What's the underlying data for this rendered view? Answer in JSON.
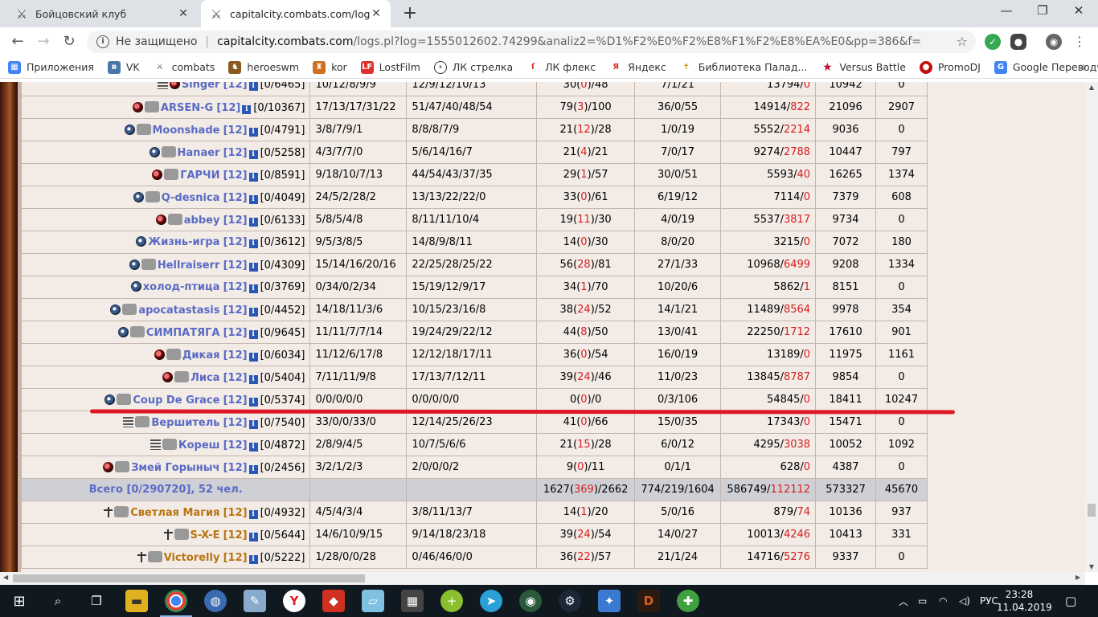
{
  "browser": {
    "tabs": [
      {
        "title": "Бойцовский клуб",
        "close": "✕"
      },
      {
        "title": "capitalcity.combats.com/logs.pl?l",
        "close": "✕"
      }
    ],
    "new_tab": "+",
    "window_controls": {
      "minimize": "—",
      "maximize": "❐",
      "close": "✕"
    },
    "address": {
      "security": "Не защищено",
      "separator": "|",
      "host": "capitalcity.combats.com",
      "path": "/logs.pl?log=1555012602.74299&analiz2=%D1%F2%E0%F2%E8%F1%F2%E8%EA%E0&pp=386&f="
    },
    "bookmarks": [
      {
        "label": "Приложения",
        "icon": "apps-grid-icon",
        "color": "#4285f4"
      },
      {
        "label": "VK",
        "icon": "vk-icon",
        "color": "#4a76a8"
      },
      {
        "label": "combats",
        "icon": "swords-icon",
        "color": "#555555"
      },
      {
        "label": "heroeswm",
        "icon": "heroes-icon",
        "color": "#8a5a20"
      },
      {
        "label": "kor",
        "icon": "kor-icon",
        "color": "#d07020"
      },
      {
        "label": "LostFilm",
        "icon": "lostfilm-icon",
        "color": "#e03030"
      },
      {
        "label": "ЛК стрелка",
        "icon": "strelka-icon",
        "color": "#333333"
      },
      {
        "label": "ЛК флекс",
        "icon": "flex-icon",
        "color": "#e03030"
      },
      {
        "label": "Яндекс",
        "icon": "yandex-icon",
        "color": "#e03030"
      },
      {
        "label": "Библиотека Палад...",
        "icon": "cross-icon",
        "color": "#c89a20"
      },
      {
        "label": "Versus Battle",
        "icon": "star-icon",
        "color": "#c01030"
      },
      {
        "label": "PromoDJ",
        "icon": "promodj-icon",
        "color": "#c01010"
      },
      {
        "label": "Google Переводчик",
        "icon": "translate-icon",
        "color": "#4285f4"
      }
    ],
    "bookmarks_more": "»"
  },
  "log_table": {
    "rows": [
      {
        "icons": [
          "grey",
          "dark"
        ],
        "name": "Singer",
        "level": "[12]",
        "hp": "[0/6465]",
        "c2": "10/12/8/9/9",
        "c3": "12/9/12/10/13",
        "c4a": "30(",
        "c4r": "0",
        "c4b": ")/48",
        "c5": "7/1/21",
        "c6a": "13794/",
        "c6r": "0",
        "c7": "10942",
        "c8": "0",
        "light": false
      },
      {
        "icons": [
          "dark",
          "clan"
        ],
        "name": "ARSEN-G",
        "level": "[12]",
        "hp": "[0/10367]",
        "c2": "17/13/17/31/22",
        "c3": "51/47/40/48/54",
        "c4a": "79(",
        "c4r": "3",
        "c4b": ")/100",
        "c5": "36/0/55",
        "c6a": "14914/",
        "c6r": "822",
        "c7": "21096",
        "c8": "2907",
        "light": false
      },
      {
        "icons": [
          "align",
          "clan"
        ],
        "name": "Moonshade",
        "level": "[12]",
        "hp": "[0/4791]",
        "c2": "3/8/7/9/1",
        "c3": "8/8/8/7/9",
        "c4a": "21(",
        "c4r": "12",
        "c4b": ")/28",
        "c5": "1/0/19",
        "c6a": "5552/",
        "c6r": "2214",
        "c7": "9036",
        "c8": "0",
        "light": false
      },
      {
        "icons": [
          "align",
          "clan"
        ],
        "name": "Hanaer",
        "level": "[12]",
        "hp": "[0/5258]",
        "c2": "4/3/7/7/0",
        "c3": "5/6/14/16/7",
        "c4a": "21(",
        "c4r": "4",
        "c4b": ")/21",
        "c5": "7/0/17",
        "c6a": "9274/",
        "c6r": "2788",
        "c7": "10447",
        "c8": "797",
        "light": false
      },
      {
        "icons": [
          "dark",
          "clan"
        ],
        "name": "ГАРЧИ",
        "level": "[12]",
        "hp": "[0/8591]",
        "c2": "9/18/10/7/13",
        "c3": "44/54/43/37/35",
        "c4a": "29(",
        "c4r": "1",
        "c4b": ")/57",
        "c5": "30/0/51",
        "c6a": "5593/",
        "c6r": "40",
        "c7": "16265",
        "c8": "1374",
        "light": false
      },
      {
        "icons": [
          "align",
          "clan"
        ],
        "name": "Q-desnica",
        "level": "[12]",
        "hp": "[0/4049]",
        "c2": "24/5/2/28/2",
        "c3": "13/13/22/22/0",
        "c4a": "33(",
        "c4r": "0",
        "c4b": ")/61",
        "c5": "6/19/12",
        "c6a": "7114/",
        "c6r": "0",
        "c7": "7379",
        "c8": "608",
        "light": false
      },
      {
        "icons": [
          "dark",
          "clan"
        ],
        "name": "abbey",
        "level": "[12]",
        "hp": "[0/6133]",
        "c2": "5/8/5/4/8",
        "c3": "8/11/11/10/4",
        "c4a": "19(",
        "c4r": "11",
        "c4b": ")/30",
        "c5": "4/0/19",
        "c6a": "5537/",
        "c6r": "3817",
        "c7": "9734",
        "c8": "0",
        "light": false
      },
      {
        "icons": [
          "align"
        ],
        "name": "Жизнь-игра",
        "level": "[12]",
        "hp": "[0/3612]",
        "c2": "9/5/3/8/5",
        "c3": "14/8/9/8/11",
        "c4a": "14(",
        "c4r": "0",
        "c4b": ")/30",
        "c5": "8/0/20",
        "c6a": "3215/",
        "c6r": "0",
        "c7": "7072",
        "c8": "180",
        "light": false
      },
      {
        "icons": [
          "align",
          "clan"
        ],
        "name": "Hellraiserr",
        "level": "[12]",
        "hp": "[0/4309]",
        "c2": "15/14/16/20/16",
        "c3": "22/25/28/25/22",
        "c4a": "56(",
        "c4r": "28",
        "c4b": ")/81",
        "c5": "27/1/33",
        "c6a": "10968/",
        "c6r": "6499",
        "c7": "9208",
        "c8": "1334",
        "light": false
      },
      {
        "icons": [
          "align"
        ],
        "name": "холод-птица",
        "level": "[12]",
        "hp": "[0/3769]",
        "c2": "0/34/0/2/34",
        "c3": "15/19/12/9/17",
        "c4a": "34(",
        "c4r": "1",
        "c4b": ")/70",
        "c5": "10/20/6",
        "c6a": "5862/",
        "c6r": "1",
        "c7": "8151",
        "c8": "0",
        "light": false
      },
      {
        "icons": [
          "align",
          "clan"
        ],
        "name": "apocatastasis",
        "level": "[12]",
        "hp": "[0/4452]",
        "c2": "14/18/11/3/6",
        "c3": "10/15/23/16/8",
        "c4a": "38(",
        "c4r": "24",
        "c4b": ")/52",
        "c5": "14/1/21",
        "c6a": "11489/",
        "c6r": "8564",
        "c7": "9978",
        "c8": "354",
        "light": false
      },
      {
        "icons": [
          "align",
          "clan"
        ],
        "name": "СИМПАТЯГА",
        "level": "[12]",
        "hp": "[0/9645]",
        "c2": "11/11/7/7/14",
        "c3": "19/24/29/22/12",
        "c4a": "44(",
        "c4r": "8",
        "c4b": ")/50",
        "c5": "13/0/41",
        "c6a": "22250/",
        "c6r": "1712",
        "c7": "17610",
        "c8": "901",
        "light": false
      },
      {
        "icons": [
          "dark",
          "clan"
        ],
        "name": "Дикая",
        "level": "[12]",
        "hp": "[0/6034]",
        "c2": "11/12/6/17/8",
        "c3": "12/12/18/17/11",
        "c4a": "36(",
        "c4r": "0",
        "c4b": ")/54",
        "c5": "16/0/19",
        "c6a": "13189/",
        "c6r": "0",
        "c7": "11975",
        "c8": "1161",
        "light": false
      },
      {
        "icons": [
          "dark",
          "clan"
        ],
        "name": "Лиса",
        "level": "[12]",
        "hp": "[0/5404]",
        "c2": "7/11/11/9/8",
        "c3": "17/13/7/12/11",
        "c4a": "39(",
        "c4r": "24",
        "c4b": ")/46",
        "c5": "11/0/23",
        "c6a": "13845/",
        "c6r": "8787",
        "c7": "9854",
        "c8": "0",
        "light": false
      },
      {
        "icons": [
          "align",
          "clan"
        ],
        "name": "Coup De Grace",
        "level": "[12]",
        "hp": "[0/5374]",
        "c2": "0/0/0/0/0",
        "c3": "0/0/0/0/0",
        "c4a": "0(",
        "c4r": "0",
        "c4b": ")/0",
        "c5": "0/3/106",
        "c6a": "54845/",
        "c6r": "0",
        "c7": "18411",
        "c8": "10247",
        "light": false
      },
      {
        "icons": [
          "grey",
          "clan"
        ],
        "name": "Вершитель",
        "level": "[12]",
        "hp": "[0/7540]",
        "c2": "33/0/0/33/0",
        "c3": "12/14/25/26/23",
        "c4a": "41(",
        "c4r": "0",
        "c4b": ")/66",
        "c5": "15/0/35",
        "c6a": "17343/",
        "c6r": "0",
        "c7": "15471",
        "c8": "0",
        "light": false
      },
      {
        "icons": [
          "grey",
          "clan"
        ],
        "name": "Кореш",
        "level": "[12]",
        "hp": "[0/4872]",
        "c2": "2/8/9/4/5",
        "c3": "10/7/5/6/6",
        "c4a": "21(",
        "c4r": "15",
        "c4b": ")/28",
        "c5": "6/0/12",
        "c6a": "4295/",
        "c6r": "3038",
        "c7": "10052",
        "c8": "1092",
        "light": false
      },
      {
        "icons": [
          "dark",
          "clan"
        ],
        "name": "Змей Горыныч",
        "level": "[12]",
        "hp": "[0/2456]",
        "c2": "3/2/1/2/3",
        "c3": "2/0/0/0/2",
        "c4a": "9(",
        "c4r": "0",
        "c4b": ")/11",
        "c5": "0/1/1",
        "c6a": "628/",
        "c6r": "0",
        "c7": "4387",
        "c8": "0",
        "light": false
      }
    ],
    "total": {
      "label": "Всего [0/290720], 52 чел.",
      "c4a": "1627(",
      "c4r": "369",
      "c4b": ")/2662",
      "c5": "774/219/1604",
      "c6a": "586749/",
      "c6r": "112112",
      "c7": "573327",
      "c8": "45670"
    },
    "rows2": [
      {
        "icons": [
          "light",
          "clan"
        ],
        "name": "Светлая Магия",
        "level": "[12]",
        "hp": "[0/4932]",
        "c2": "4/5/4/3/4",
        "c3": "3/8/11/13/7",
        "c4a": "14(",
        "c4r": "1",
        "c4b": ")/20",
        "c5": "5/0/16",
        "c6a": "879/",
        "c6r": "74",
        "c7": "10136",
        "c8": "937",
        "light": true
      },
      {
        "icons": [
          "light",
          "clan"
        ],
        "name": "S-X-E",
        "level": "[12]",
        "hp": "[0/5644]",
        "c2": "14/6/10/9/15",
        "c3": "9/14/18/23/18",
        "c4a": "39(",
        "c4r": "24",
        "c4b": ")/54",
        "c5": "14/0/27",
        "c6a": "10013/",
        "c6r": "4246",
        "c7": "10413",
        "c8": "331",
        "light": true
      },
      {
        "icons": [
          "light",
          "clan"
        ],
        "name": "Victorelly",
        "level": "[12]",
        "hp": "[0/5222]",
        "c2": "1/28/0/0/28",
        "c3": "0/46/46/0/0",
        "c4a": "36(",
        "c4r": "22",
        "c4b": ")/57",
        "c5": "21/1/24",
        "c6a": "14716/",
        "c6r": "5276",
        "c7": "9337",
        "c8": "0",
        "light": true
      }
    ]
  },
  "taskbar": {
    "apps": [
      "start-icon",
      "search-icon",
      "task-view-icon",
      "explorer-icon",
      "chrome-icon",
      "app-globe-icon",
      "paint-icon",
      "yandex-icon",
      "app-red-icon",
      "app-notes-icon",
      "calculator-icon",
      "app-plus-icon",
      "telegram-icon",
      "app-green-icon",
      "steam-icon",
      "app-blue-icon",
      "diablo-icon",
      "app-shield-icon"
    ],
    "lang": "РУС",
    "time": "23:28",
    "date": "11.04.2019"
  }
}
